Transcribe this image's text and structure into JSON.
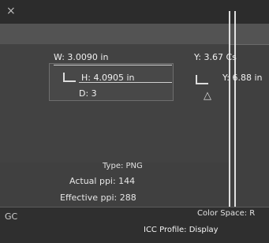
{
  "window": {
    "close_glyph": "×"
  },
  "dimensions": {
    "width_label": "W: 3.0090 in",
    "height_label": "H: 4.0905 in",
    "depth_label": "D: 3"
  },
  "position": {
    "y_label": "Y: 3.67 Cs",
    "y2_label": "Y: 6.88 in"
  },
  "info": {
    "type": "Type: PNG",
    "actual_ppi": "Actual ppi: 144",
    "effective_ppi": "Effective ppi: 288"
  },
  "footer": {
    "left_text": "GC",
    "color_space": "Color Space: R",
    "icc_profile": "ICC Profile: Display"
  }
}
